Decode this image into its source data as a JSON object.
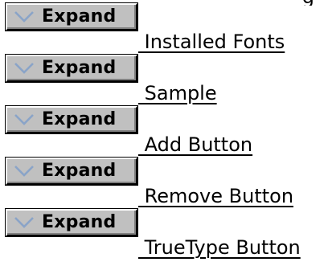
{
  "expand_label": "Expand",
  "cut_text": "g",
  "rows": [
    {
      "button_label": "Expand",
      "icon": "chevron-down-icon",
      "link_text": " Installed Fonts"
    },
    {
      "button_label": "Expand",
      "icon": "chevron-down-icon",
      "link_text": " Sample"
    },
    {
      "button_label": "Expand",
      "icon": "chevron-down-icon",
      "link_text": " Add Button"
    },
    {
      "button_label": "Expand",
      "icon": "chevron-down-icon",
      "link_text": " Remove Button"
    },
    {
      "button_label": "Expand",
      "icon": "chevron-down-icon",
      "link_text": " TrueType Button"
    }
  ],
  "colors": {
    "button_face": "#c0c0c0",
    "chevron": "#8aa4c8",
    "text": "#000000",
    "background": "#ffffff"
  }
}
